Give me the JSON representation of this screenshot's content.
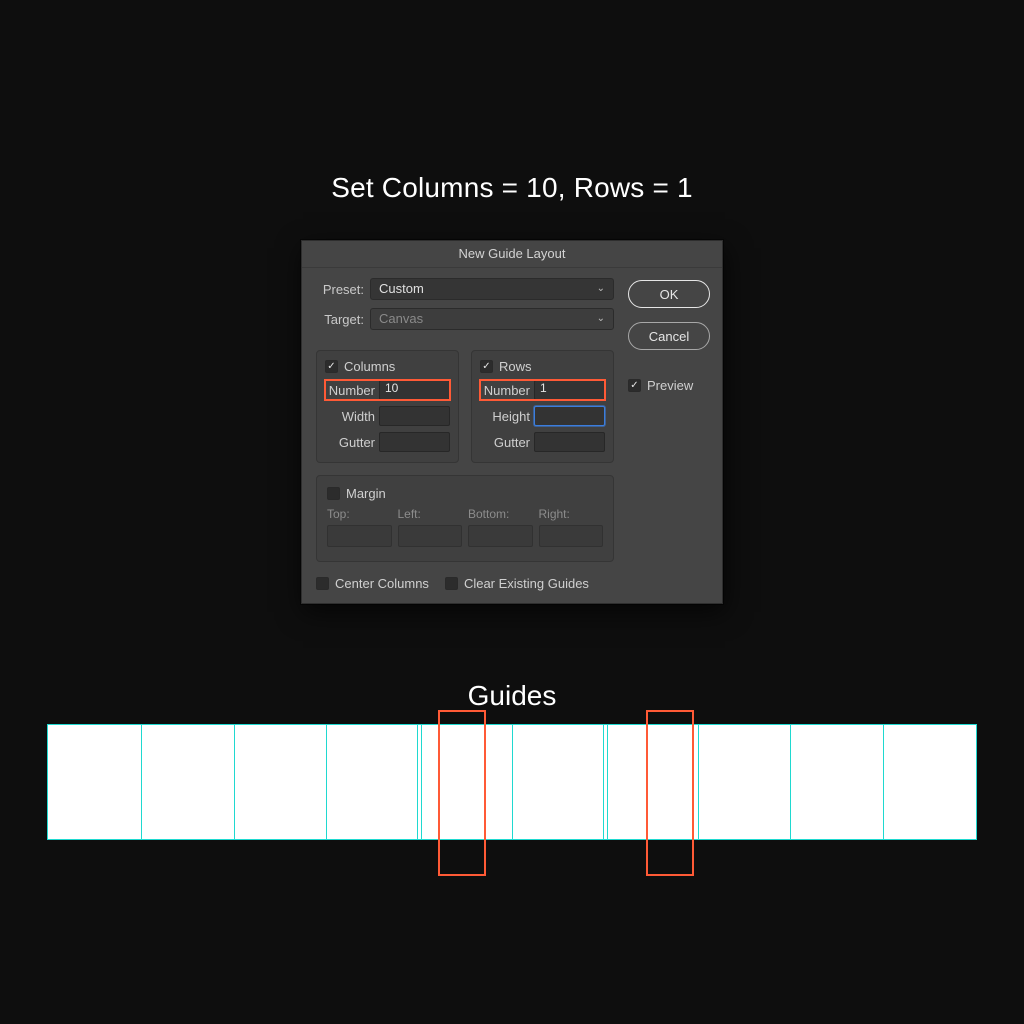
{
  "instruction": "Set Columns = 10, Rows = 1",
  "dialog": {
    "title": "New Guide Layout",
    "preset_label": "Preset:",
    "preset_value": "Custom",
    "target_label": "Target:",
    "target_value": "Canvas",
    "columns": {
      "section": "Columns",
      "number_label": "Number",
      "number_value": "10",
      "width_label": "Width",
      "width_value": "",
      "gutter_label": "Gutter",
      "gutter_value": ""
    },
    "rows": {
      "section": "Rows",
      "number_label": "Number",
      "number_value": "1",
      "height_label": "Height",
      "height_value": "",
      "gutter_label": "Gutter",
      "gutter_value": ""
    },
    "margin": {
      "section": "Margin",
      "top": "Top:",
      "left": "Left:",
      "bottom": "Bottom:",
      "right": "Right:"
    },
    "center_columns": "Center Columns",
    "clear_guides": "Clear Existing Guides",
    "ok": "OK",
    "cancel": "Cancel",
    "preview": "Preview"
  },
  "guides_heading": "Guides",
  "guides": {
    "count": 10,
    "bundle_indices": [
      4,
      6
    ]
  }
}
